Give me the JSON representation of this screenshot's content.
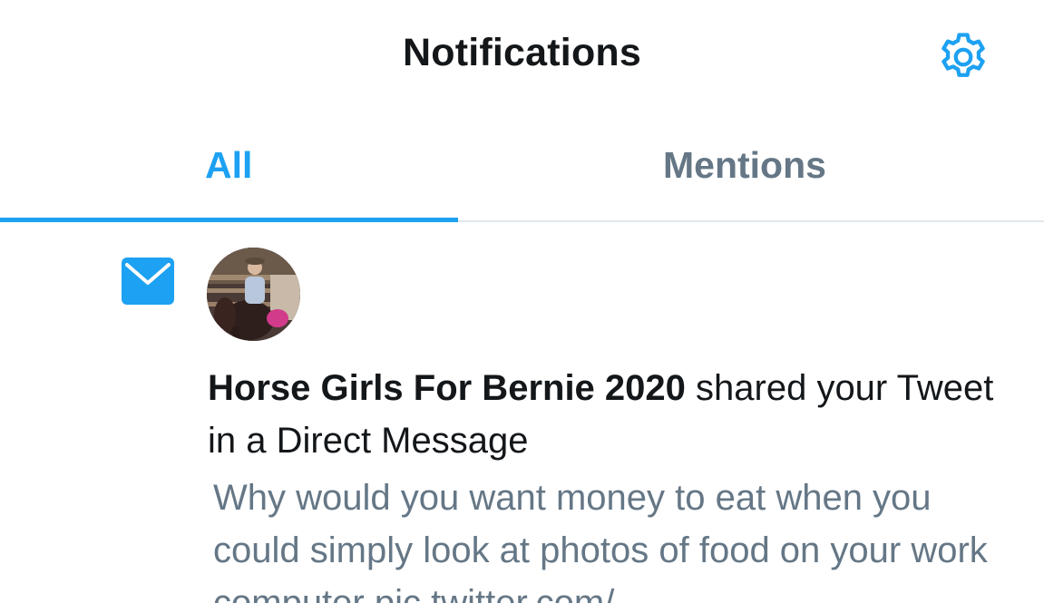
{
  "header": {
    "title": "Notifications",
    "settings_icon": "gear-icon"
  },
  "tabs": [
    {
      "label": "All",
      "active": true
    },
    {
      "label": "Mentions",
      "active": false
    }
  ],
  "colors": {
    "accent": "#1da1f2",
    "text_primary": "#14171a",
    "text_secondary": "#657786",
    "divider": "#e1e8ed"
  },
  "notification": {
    "type_icon": "envelope-icon",
    "user_name": "Horse Girls For Bernie 2020",
    "action_text": " shared your Tweet in a Direct Message",
    "tweet_text": "Why would you want money to eat when you could simply look at photos of food on your work computer pic.twitter.com/"
  }
}
